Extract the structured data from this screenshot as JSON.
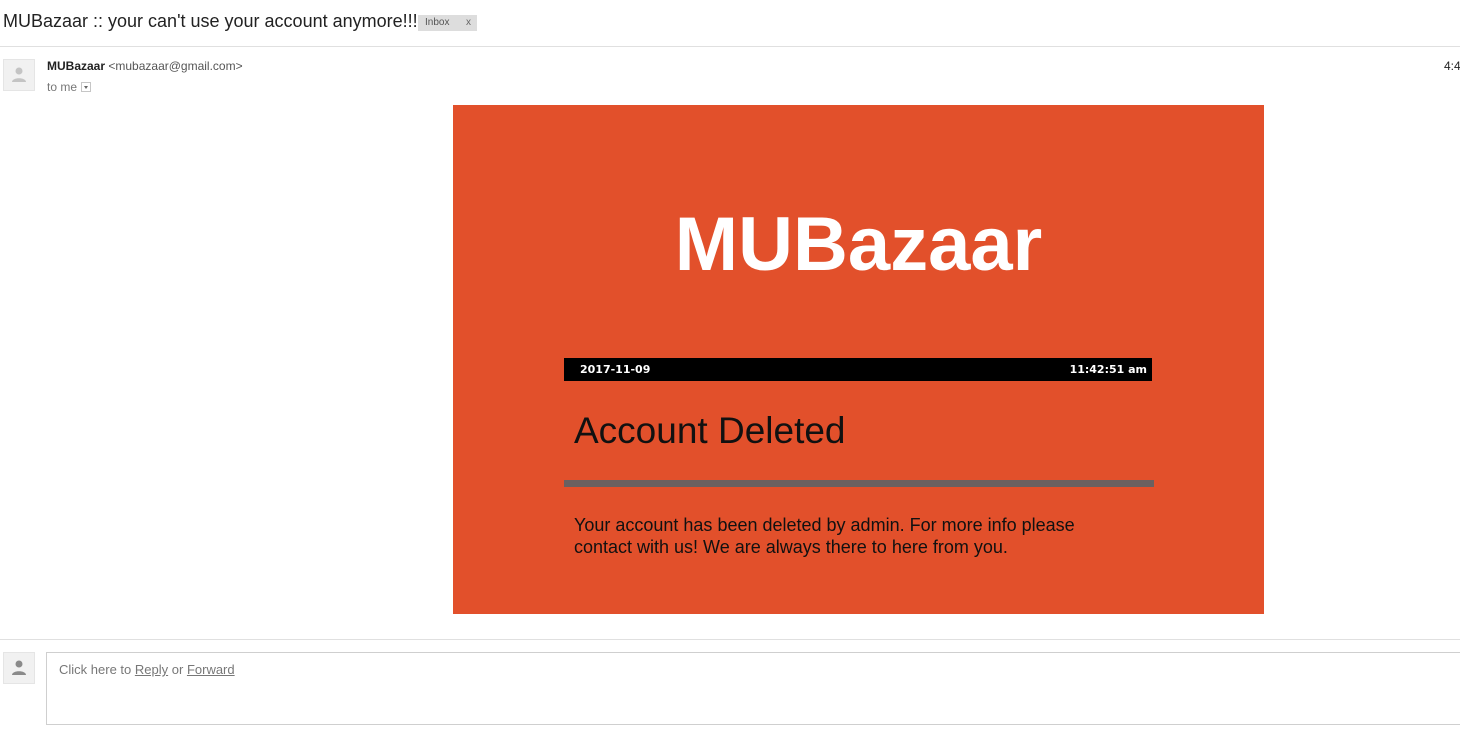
{
  "subject": {
    "title": "MUBazaar :: your can't use your account anymore!!!",
    "label": "Inbox",
    "label_remove": "x"
  },
  "header": {
    "sender_name": "MUBazaar",
    "sender_email": "<mubazaar@gmail.com>",
    "recipient": "to me",
    "time": "4:4",
    "avatar_icon": "person-icon"
  },
  "email": {
    "brand": "MUBazaar",
    "date": "2017-11-09",
    "clock": "11:42:51 am",
    "heading": "Account Deleted",
    "body": "Your account has been deleted by admin. For more info please contact with us! We are always there to here from you.",
    "colors": {
      "background": "#e2502b",
      "date_bar": "#000000",
      "divider": "#6a6060",
      "brand_text": "#ffffff"
    }
  },
  "reply": {
    "prefix": "Click here to",
    "reply_link": "Reply",
    "or_text": "or",
    "forward_link": "Forward"
  }
}
